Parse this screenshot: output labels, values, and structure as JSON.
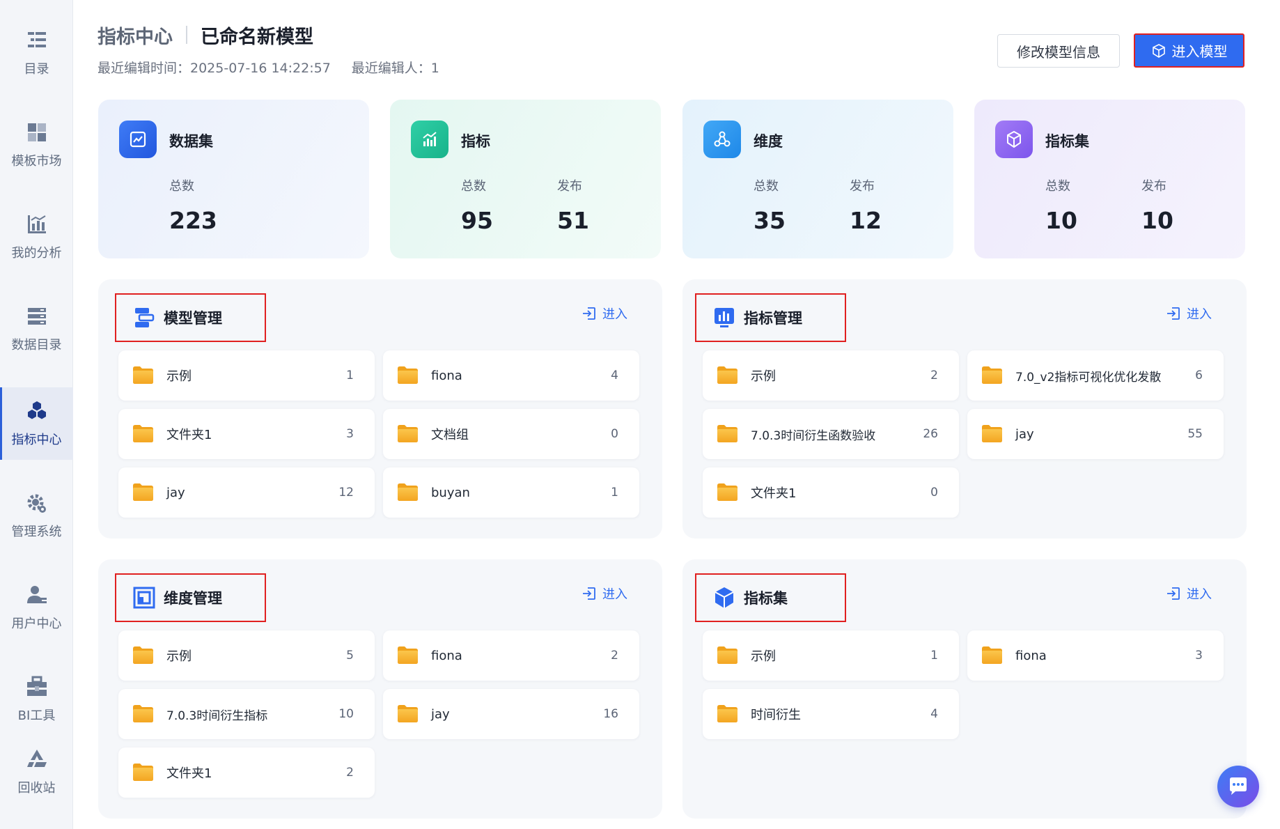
{
  "sidebar": {
    "items": [
      {
        "label": "目录",
        "icon": "catalog-icon"
      },
      {
        "label": "模板市场",
        "icon": "template-market-icon"
      },
      {
        "label": "我的分析",
        "icon": "analysis-icon"
      },
      {
        "label": "数据目录",
        "icon": "data-catalog-icon"
      },
      {
        "label": "指标中心",
        "icon": "metric-center-icon"
      },
      {
        "label": "管理系统",
        "icon": "admin-gear-icon"
      },
      {
        "label": "用户中心",
        "icon": "user-icon"
      },
      {
        "label": "BI工具",
        "icon": "bi-tool-icon"
      },
      {
        "label": "回收站",
        "icon": "recycle-icon"
      }
    ]
  },
  "header": {
    "breadcrumb_root": "指标中心",
    "model_name": "已命名新模型",
    "last_edit_time": "最近编辑时间：2025-07-16 14:22:57",
    "last_editor": "最近编辑人：1",
    "edit_button": "修改模型信息",
    "enter_button": "进入模型"
  },
  "stats": {
    "dataset": {
      "title": "数据集",
      "total_label": "总数",
      "total": "223"
    },
    "metric": {
      "title": "指标",
      "total_label": "总数",
      "total": "95",
      "pub_label": "发布",
      "pub": "51"
    },
    "dimension": {
      "title": "维度",
      "total_label": "总数",
      "total": "35",
      "pub_label": "发布",
      "pub": "12"
    },
    "metric_set": {
      "title": "指标集",
      "total_label": "总数",
      "total": "10",
      "pub_label": "发布",
      "pub": "10"
    }
  },
  "panels": {
    "enter_label": "进入",
    "model": {
      "title": "模型管理",
      "folders": [
        {
          "name": "示例",
          "count": "1"
        },
        {
          "name": "fiona",
          "count": "4"
        },
        {
          "name": "文件夹1",
          "count": "3"
        },
        {
          "name": "文档组",
          "count": "0"
        },
        {
          "name": "jay",
          "count": "12"
        },
        {
          "name": "buyan",
          "count": "1"
        }
      ]
    },
    "metric": {
      "title": "指标管理",
      "folders": [
        {
          "name": "示例",
          "count": "2"
        },
        {
          "name": "7.0_v2指标可视化优化发散",
          "count": "6"
        },
        {
          "name": "7.0.3时间衍生函数验收",
          "count": "26"
        },
        {
          "name": "jay",
          "count": "55"
        },
        {
          "name": "文件夹1",
          "count": "0"
        }
      ]
    },
    "dimension": {
      "title": "维度管理",
      "folders": [
        {
          "name": "示例",
          "count": "5"
        },
        {
          "name": "fiona",
          "count": "2"
        },
        {
          "name": "7.0.3时间衍生指标",
          "count": "10"
        },
        {
          "name": "jay",
          "count": "16"
        },
        {
          "name": "文件夹1",
          "count": "2"
        }
      ]
    },
    "metric_set": {
      "title": "指标集",
      "folders": [
        {
          "name": "示例",
          "count": "1"
        },
        {
          "name": "fiona",
          "count": "3"
        },
        {
          "name": "时间衍生",
          "count": "4"
        }
      ]
    }
  },
  "colors": {
    "accent": "#2f6bf0",
    "highlight_border": "#e02020",
    "folder": "#f7b233"
  }
}
